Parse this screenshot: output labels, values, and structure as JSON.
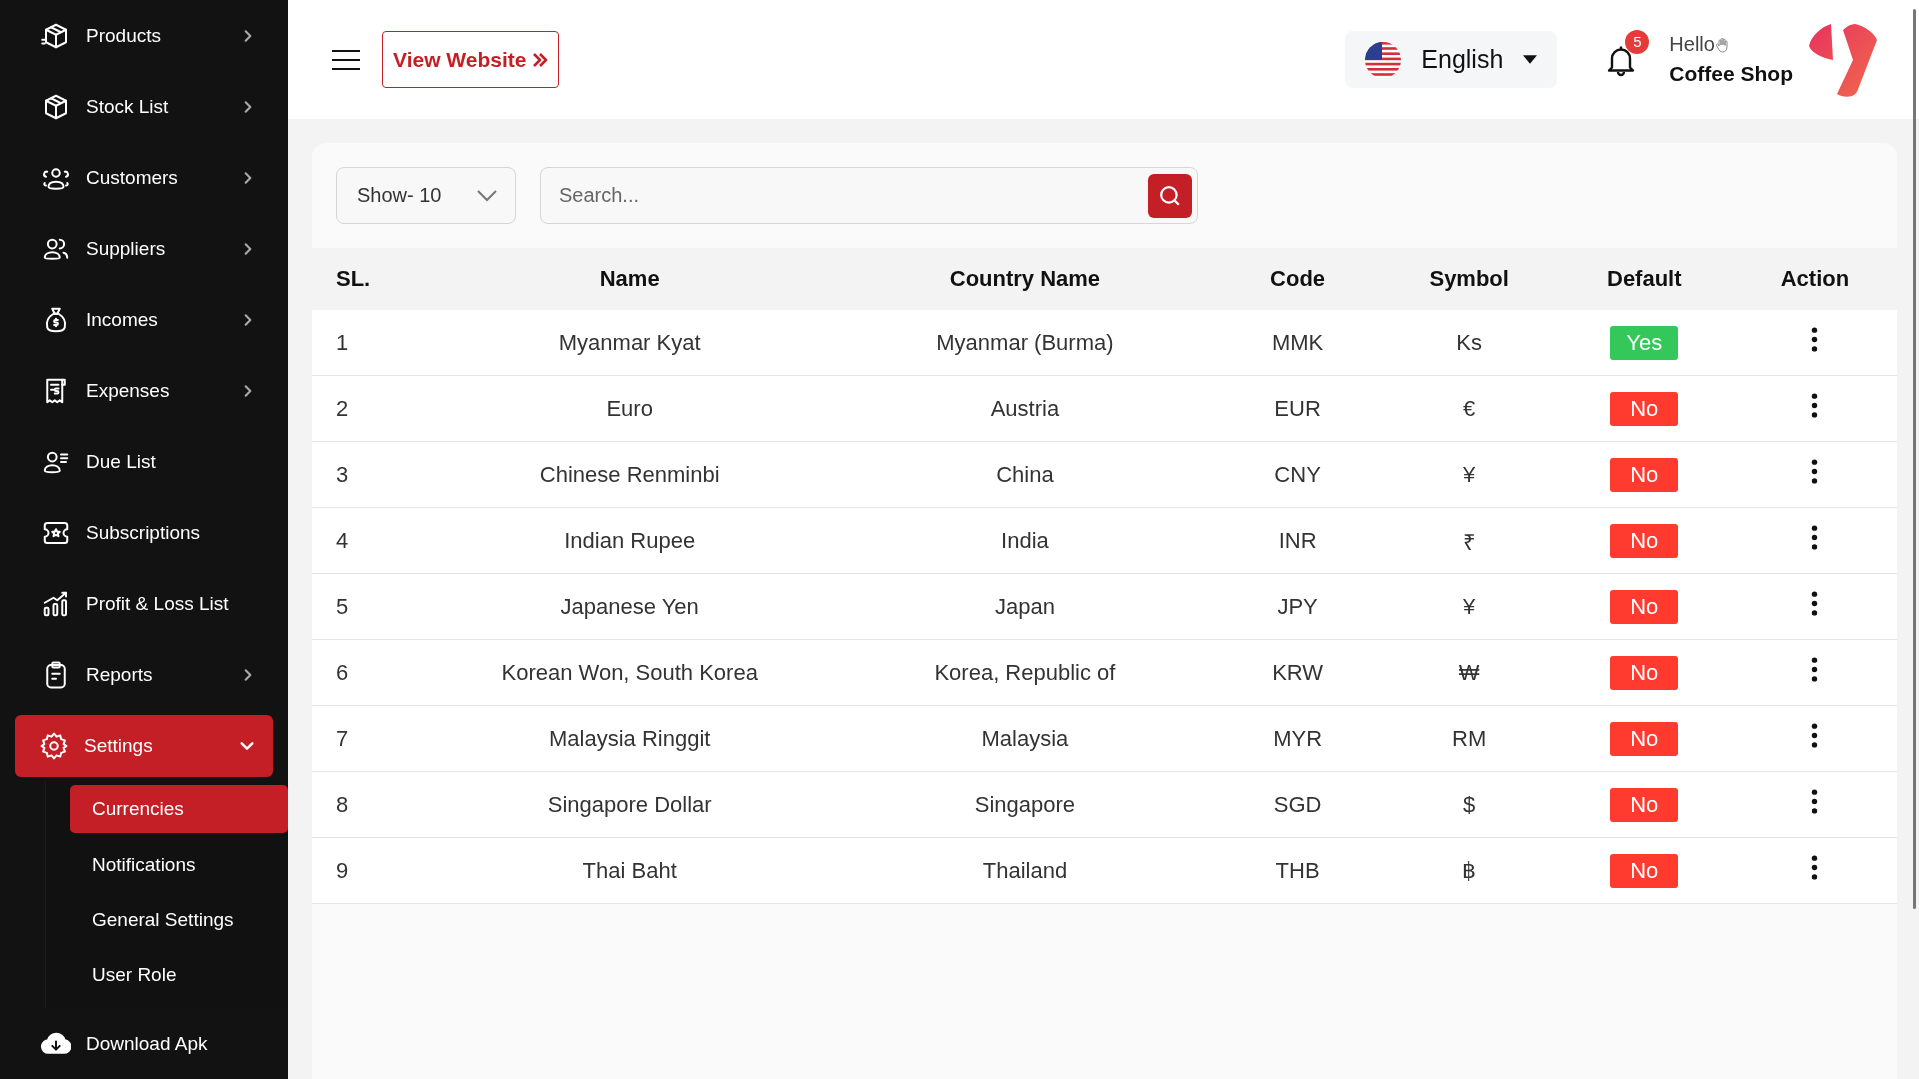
{
  "sidebar": {
    "items": [
      {
        "label": "Products",
        "has_submenu": true,
        "expanded": false,
        "selected": false
      },
      {
        "label": "Stock List",
        "has_submenu": true,
        "expanded": false,
        "selected": false
      },
      {
        "label": "Customers",
        "has_submenu": true,
        "expanded": false,
        "selected": false
      },
      {
        "label": "Suppliers",
        "has_submenu": true,
        "expanded": false,
        "selected": false
      },
      {
        "label": "Incomes",
        "has_submenu": true,
        "expanded": false,
        "selected": false
      },
      {
        "label": "Expenses",
        "has_submenu": true,
        "expanded": false,
        "selected": false
      },
      {
        "label": "Due List",
        "has_submenu": false,
        "selected": false
      },
      {
        "label": "Subscriptions",
        "has_submenu": false,
        "selected": false
      },
      {
        "label": "Profit & Loss List",
        "has_submenu": false,
        "selected": false
      },
      {
        "label": "Reports",
        "has_submenu": true,
        "expanded": false,
        "selected": false
      },
      {
        "label": "Settings",
        "has_submenu": true,
        "expanded": true,
        "selected": true,
        "children": [
          {
            "label": "Currencies",
            "selected": true
          },
          {
            "label": "Notifications",
            "selected": false
          },
          {
            "label": "General Settings",
            "selected": false
          },
          {
            "label": "User Role",
            "selected": false
          }
        ]
      },
      {
        "label": "Download Apk",
        "has_submenu": false,
        "selected": false
      }
    ]
  },
  "header": {
    "view_website": "View Website",
    "language": "English",
    "notification_count": "5",
    "greeting": "Hello",
    "user_name": "Coffee Shop"
  },
  "toolbar": {
    "show": "Show- 10",
    "search": {
      "placeholder": "Search..."
    }
  },
  "table": {
    "columns": [
      "SL.",
      "Name",
      "Country Name",
      "Code",
      "Symbol",
      "Default",
      "Action"
    ],
    "rows": [
      {
        "sl": "1",
        "name": "Myanmar Kyat",
        "country": "Myanmar (Burma)",
        "code": "MMK",
        "symbol": "Ks",
        "default": true,
        "default_label": "Yes"
      },
      {
        "sl": "2",
        "name": "Euro",
        "country": "Austria",
        "code": "EUR",
        "symbol": "€",
        "default": false,
        "default_label": "No"
      },
      {
        "sl": "3",
        "name": "Chinese Renminbi",
        "country": "China",
        "code": "CNY",
        "symbol": "¥",
        "default": false,
        "default_label": "No"
      },
      {
        "sl": "4",
        "name": "Indian Rupee",
        "country": "India",
        "code": "INR",
        "symbol": "₹",
        "default": false,
        "default_label": "No"
      },
      {
        "sl": "5",
        "name": "Japanese Yen",
        "country": "Japan",
        "code": "JPY",
        "symbol": "¥",
        "default": false,
        "default_label": "No"
      },
      {
        "sl": "6",
        "name": "Korean Won, South Korea",
        "country": "Korea, Republic of",
        "code": "KRW",
        "symbol": "₩",
        "default": false,
        "default_label": "No"
      },
      {
        "sl": "7",
        "name": "Malaysia Ringgit",
        "country": "Malaysia",
        "code": "MYR",
        "symbol": "RM",
        "default": false,
        "default_label": "No"
      },
      {
        "sl": "8",
        "name": "Singapore Dollar",
        "country": "Singapore",
        "code": "SGD",
        "symbol": "$",
        "default": false,
        "default_label": "No"
      },
      {
        "sl": "9",
        "name": "Thai Baht",
        "country": "Thailand",
        "code": "THB",
        "symbol": "฿",
        "default": false,
        "default_label": "No"
      }
    ]
  }
}
